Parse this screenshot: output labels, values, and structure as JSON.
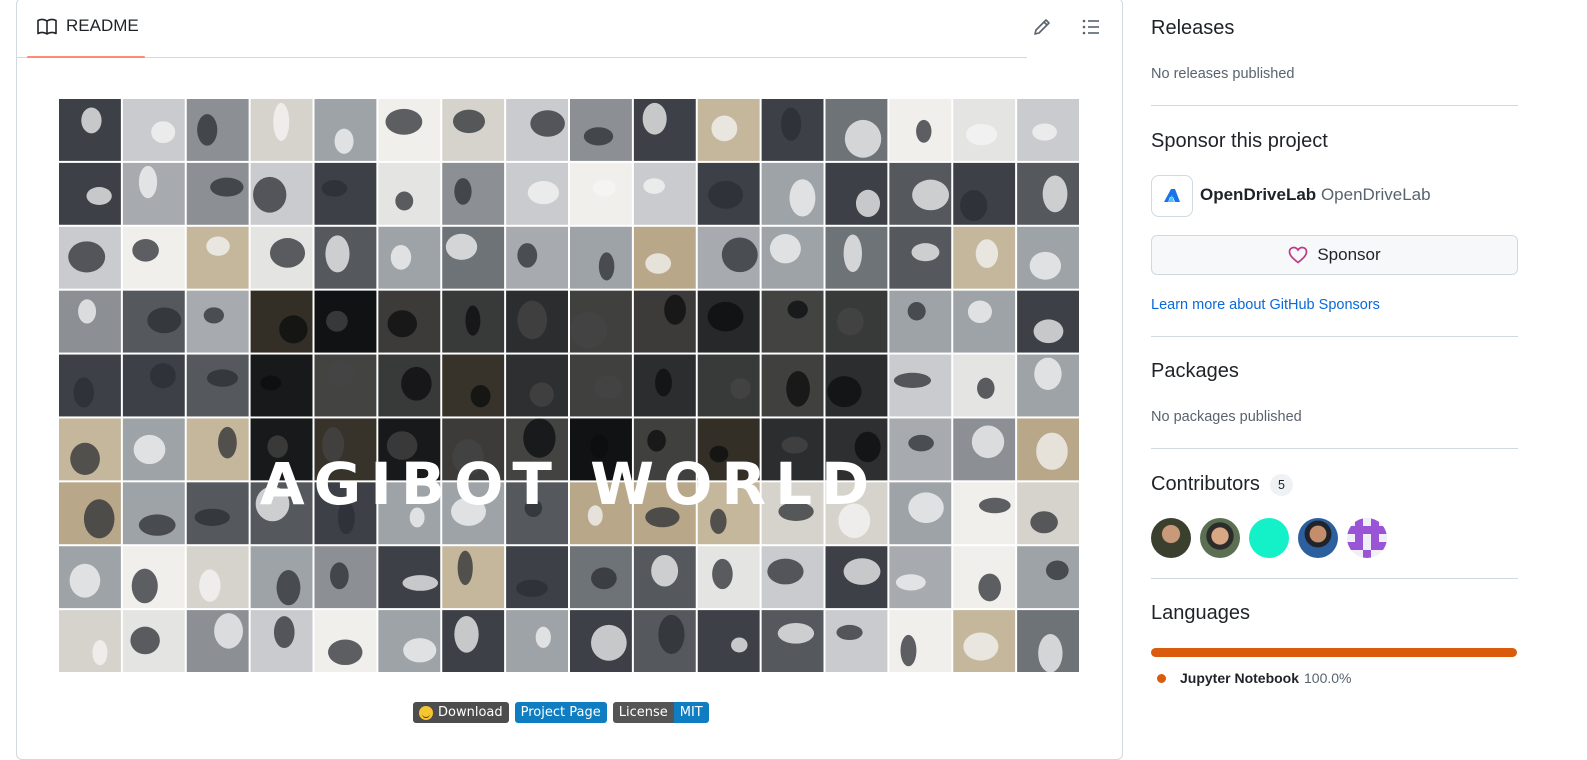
{
  "readme": {
    "tab_label": "README",
    "edit_icon": "pencil-icon",
    "outline_icon": "list-icon",
    "banner_title": "AGIBOT WORLD",
    "badges": {
      "download": "Download",
      "project_page": "Project Page",
      "license_left": "License",
      "license_right": "MIT"
    }
  },
  "sidebar": {
    "releases": {
      "title": "Releases",
      "empty": "No releases published"
    },
    "sponsor": {
      "title": "Sponsor this project",
      "org_login": "OpenDriveLab",
      "org_name": "OpenDriveLab",
      "button_label": "Sponsor",
      "learn_more": "Learn more about GitHub Sponsors"
    },
    "packages": {
      "title": "Packages",
      "empty": "No packages published"
    },
    "contributors": {
      "title": "Contributors",
      "count": "5"
    },
    "languages": {
      "title": "Languages",
      "items": [
        {
          "name": "Jupyter Notebook",
          "percent": "100.0%",
          "color": "#da5b0b"
        }
      ]
    }
  },
  "colors": {
    "link": "#0969da",
    "tab_underline": "#fd8c73",
    "heart": "#bf3989",
    "jupyter": "#da5b0b"
  }
}
